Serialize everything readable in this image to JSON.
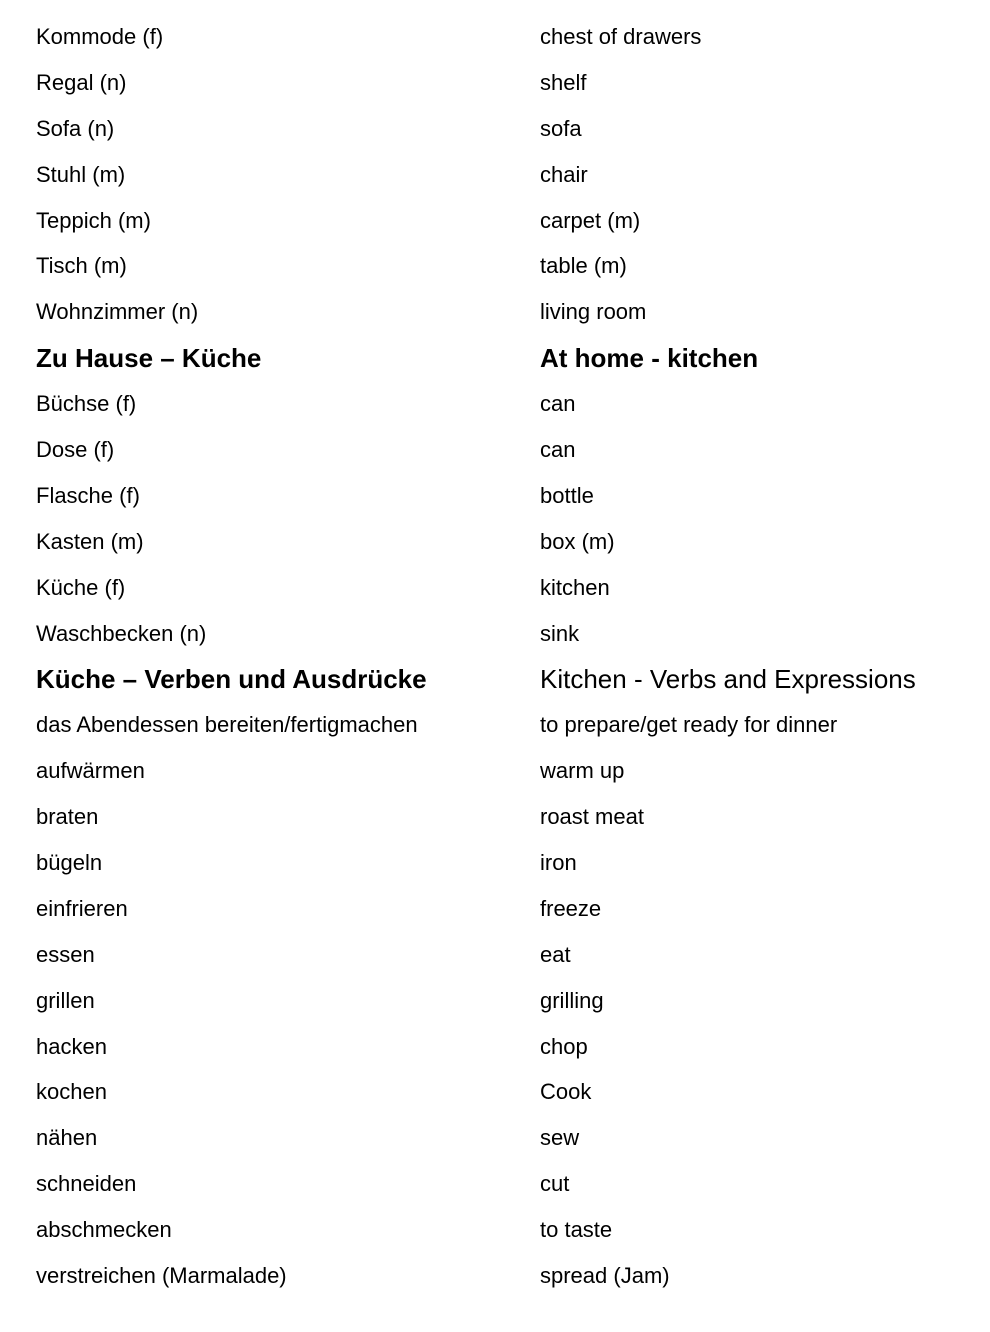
{
  "document": {
    "rows": [
      {
        "type": "entry",
        "de": "Kommode (f)",
        "en": "chest of drawers"
      },
      {
        "type": "entry",
        "de": "Regal (n)",
        "en": "shelf"
      },
      {
        "type": "entry",
        "de": "Sofa (n)",
        "en": "sofa"
      },
      {
        "type": "entry",
        "de": "Stuhl (m)",
        "en": "chair"
      },
      {
        "type": "entry",
        "de": "Teppich (m)",
        "en": "carpet (m)"
      },
      {
        "type": "entry",
        "de": "Tisch (m)",
        "en": "table (m)"
      },
      {
        "type": "entry",
        "de": "Wohnzimmer (n)",
        "en": "living room"
      },
      {
        "type": "heading",
        "de": "Zu Hause – Küche",
        "en": "At home - kitchen",
        "en_bold": true
      },
      {
        "type": "entry",
        "de": "Büchse (f)",
        "en": "can"
      },
      {
        "type": "entry",
        "de": "Dose (f)",
        "en": "can"
      },
      {
        "type": "entry",
        "de": "Flasche (f)",
        "en": "bottle"
      },
      {
        "type": "entry",
        "de": "Kasten (m)",
        "en": "box (m)"
      },
      {
        "type": "entry",
        "de": "Küche (f)",
        "en": "kitchen"
      },
      {
        "type": "entry",
        "de": "Waschbecken (n)",
        "en": "sink"
      },
      {
        "type": "heading",
        "de": "Küche – Verben und Ausdrücke",
        "en": "Kitchen - Verbs and Expressions",
        "en_bold": false
      },
      {
        "type": "entry",
        "de": "das Abendessen bereiten/fertigmachen",
        "en": "to prepare/get ready for dinner"
      },
      {
        "type": "entry",
        "de": "aufwärmen",
        "en": "warm up"
      },
      {
        "type": "entry",
        "de": "braten",
        "en": "roast meat"
      },
      {
        "type": "entry",
        "de": "bügeln",
        "en": "iron"
      },
      {
        "type": "entry",
        "de": "einfrieren",
        "en": "freeze"
      },
      {
        "type": "entry",
        "de": "essen",
        "en": "eat"
      },
      {
        "type": "entry",
        "de": "grillen",
        "en": "grilling"
      },
      {
        "type": "entry",
        "de": "hacken",
        "en": "chop"
      },
      {
        "type": "entry",
        "de": "kochen",
        "en": "Cook"
      },
      {
        "type": "entry",
        "de": "nähen",
        "en": "sew"
      },
      {
        "type": "entry",
        "de": "schneiden",
        "en": "cut"
      },
      {
        "type": "entry",
        "de": "abschmecken",
        "en": "to taste"
      },
      {
        "type": "entry",
        "de": "verstreichen (Marmalade)",
        "en": "spread (Jam)"
      }
    ]
  }
}
